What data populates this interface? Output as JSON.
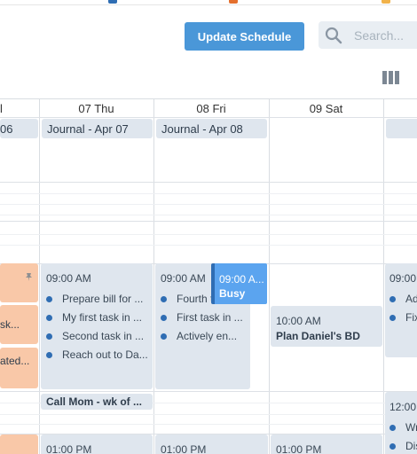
{
  "toolbar": {
    "update_label": "Update Schedule",
    "search_placeholder": "Search..."
  },
  "days": [
    {
      "label": "07 Thu"
    },
    {
      "label": "08 Fri"
    },
    {
      "label": "09 Sat"
    }
  ],
  "all_day": {
    "left_partial": "06",
    "thu": "Journal - Apr 07",
    "fri": "Journal - Apr 08"
  },
  "events": {
    "left_partial": {
      "line1": "sk...",
      "line2": "ated..."
    },
    "thu_morning": {
      "time": "09:00 AM",
      "items": [
        "Prepare bill for ...",
        "My first task in ...",
        "Second task in ...",
        "Reach out to Da..."
      ]
    },
    "thu_call": {
      "title": "Call Mom - wk of ..."
    },
    "fri_morning": {
      "time": "09:00 AM",
      "items": [
        "Fourth t",
        "First task in ...",
        "Actively en..."
      ]
    },
    "fri_busy": {
      "time": "09:00 A...",
      "title": "Busy"
    },
    "sat_plan": {
      "time": "10:00 AM",
      "title": "Plan Daniel's BD"
    },
    "right_partial_top": {
      "time": "09:00",
      "items": [
        "Ad",
        "Fix"
      ]
    },
    "right_partial_bottom": {
      "time": "12:00",
      "items": [
        "Wr",
        "Dis"
      ]
    },
    "thu_1pm": {
      "time": "01:00 PM"
    },
    "fri_1pm": {
      "time": "01:00 PM"
    },
    "sat_1pm": {
      "time": "01:00 PM"
    }
  },
  "colors": {
    "accent": "#4a97d8",
    "event_bg": "#dfe6ee",
    "peach": "#f9c8a8",
    "busy": "#5ba4ef",
    "dot": "#2f6db3"
  }
}
